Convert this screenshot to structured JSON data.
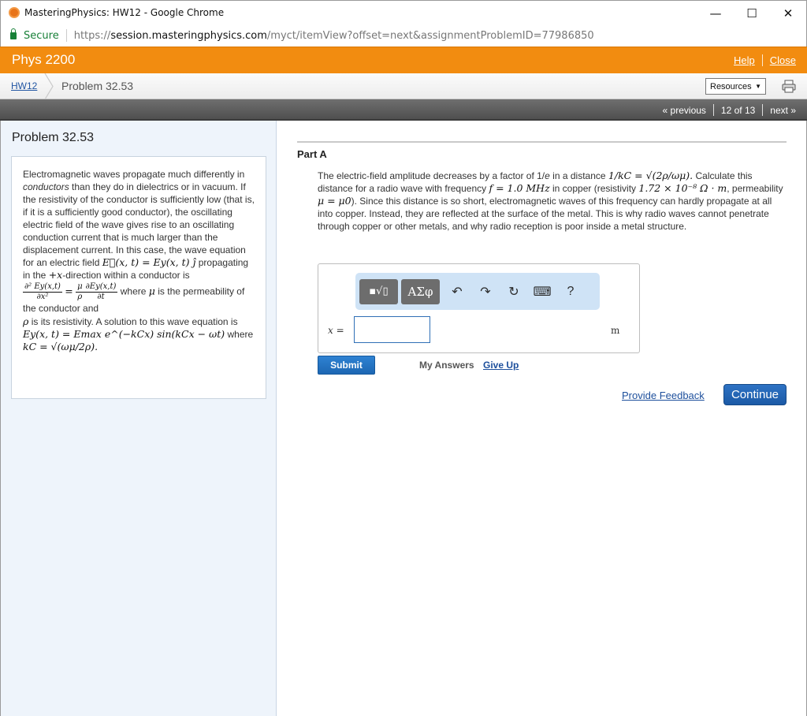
{
  "window": {
    "title": "MasteringPhysics: HW12 - Google Chrome",
    "minimize": "—",
    "maximize": "☐",
    "close": "✕"
  },
  "address": {
    "secure_label": "Secure",
    "url_protocol": "https://",
    "url_host": "session.masteringphysics.com",
    "url_rest": "/myct/itemView?offset=next&assignmentProblemID=77986850"
  },
  "course": {
    "title": "Phys 2200",
    "help_label": "Help",
    "close_label": "Close"
  },
  "breadcrumb": {
    "assignment": "HW12",
    "current": "Problem 32.53",
    "resources_label": "Resources",
    "resources_arrow": "▼"
  },
  "navigation": {
    "previous_label": "« previous",
    "position": "12 of 13",
    "next_label": "next »"
  },
  "problem": {
    "title": "Problem 32.53",
    "p1": "Electromagnetic waves propagate much differently in",
    "p1_em": "conductors",
    "p2": "than they do in dielectrics or in vacuum. If the resistivity of the conductor is sufficiently low (that is, if it is a sufficiently good conductor), the oscillating electric field of the wave gives rise to an oscillating conduction current that is much larger than the displacement current. In this case, the wave equation for an electric field",
    "eq_field": "E⃗(x, t) = Ey(x, t) ĵ",
    "p3": "propagating in the",
    "eq_dir": "+x",
    "p4": "-direction within a conductor is",
    "eq_lhs_num": "∂² Ey(x,t)",
    "eq_lhs_den": "∂x²",
    "eq_eq": "=",
    "eq_mu": "μ",
    "eq_rho": "ρ",
    "eq_rhs_num": "∂Ey(x,t)",
    "eq_rhs_den": "∂t",
    "p5": "where",
    "eq_mu2": "μ",
    "p6": "is the permeability of the conductor and",
    "eq_rho2": "ρ",
    "p7": "is its resistivity. A solution to this wave equation is",
    "eq_solution": "Ey(x, t) = Emax e^(−kCx) sin(kCx − ωt)",
    "p8": "where",
    "eq_kc": "kC = √(ωμ/2ρ)."
  },
  "part": {
    "label": "Part A",
    "q1": "The electric-field amplitude decreases by a factor of 1/",
    "q1_e": "e",
    "q2": "in a distance",
    "q_dist": "1/kC = √(2ρ/ωμ).",
    "q3": "Calculate this distance for a radio wave with frequency",
    "q_freq": "f = 1.0 MHz",
    "q4": "in copper (resistivity",
    "q_res": "1.72 × 10⁻⁸ Ω · m",
    "q5": ", permeability",
    "q_perm": "μ = μ0",
    "q6": "). Since this distance is so short, electromagnetic waves of this frequency can hardly propagate at all into copper. Instead, they are reflected at the surface of the metal. This is why radio waves cannot penetrate through copper or other metals, and why radio reception is poor inside a metal structure."
  },
  "answer": {
    "templates_icon": "▪√▯",
    "greek_label": "ΑΣφ",
    "undo_icon": "↶",
    "redo_icon": "↷",
    "reset_icon": "↻",
    "keyboard_icon": "⌨",
    "help_icon": "?",
    "variable_label": "x =",
    "input_value": "",
    "unit": "m"
  },
  "actions": {
    "submit_label": "Submit",
    "my_answers_label": "My Answers",
    "give_up_label": "Give Up",
    "feedback_label": "Provide Feedback",
    "continue_label": "Continue"
  },
  "colors": {
    "course_bar": "#f28c10",
    "nav_bar": "#5a5a5a",
    "left_panel": "#eef4fb",
    "button_blue": "#1d67b3",
    "link_blue": "#1d4f9c",
    "toolbar_bg": "#cfe3f6"
  }
}
